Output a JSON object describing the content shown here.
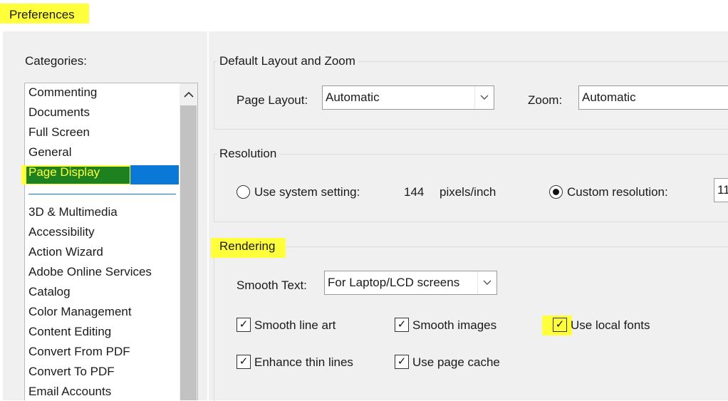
{
  "window": {
    "title": "Preferences"
  },
  "categories": {
    "label": "Categories:",
    "items": [
      "Commenting",
      "Documents",
      "Full Screen",
      "General",
      "Page Display"
    ],
    "more_items": [
      "3D & Multimedia",
      "Accessibility",
      "Action Wizard",
      "Adobe Online Services",
      "Catalog",
      "Color Management",
      "Content Editing",
      "Convert From PDF",
      "Convert To PDF",
      "Email Accounts"
    ],
    "selected": "Page Display"
  },
  "layout_zoom": {
    "title": "Default Layout and Zoom",
    "page_layout_label": "Page Layout:",
    "page_layout_value": "Automatic",
    "zoom_label": "Zoom:",
    "zoom_value": "Automatic"
  },
  "resolution": {
    "title": "Resolution",
    "system_label": "Use system setting:",
    "system_value": "144",
    "system_unit": "pixels/inch",
    "custom_label": "Custom resolution:",
    "custom_value": "11",
    "selected": "custom"
  },
  "rendering": {
    "title": "Rendering",
    "smooth_text_label": "Smooth Text:",
    "smooth_text_value": "For Laptop/LCD screens",
    "checkboxes": {
      "smooth_line_art": {
        "label": "Smooth line art",
        "checked": true
      },
      "smooth_images": {
        "label": "Smooth images",
        "checked": true
      },
      "use_local_fonts": {
        "label": "Use local fonts",
        "checked": true
      },
      "enhance_thin_lines": {
        "label": "Enhance thin lines",
        "checked": true
      },
      "use_page_cache": {
        "label": "Use page cache",
        "checked": true
      }
    }
  },
  "icons": {
    "scroll_up": "chevron-up-icon",
    "dropdown": "chevron-down-icon",
    "check": "check-icon"
  },
  "colors": {
    "highlight": "#ffff3c",
    "selection": "#0a78d7",
    "panel": "#f0f0f0"
  }
}
